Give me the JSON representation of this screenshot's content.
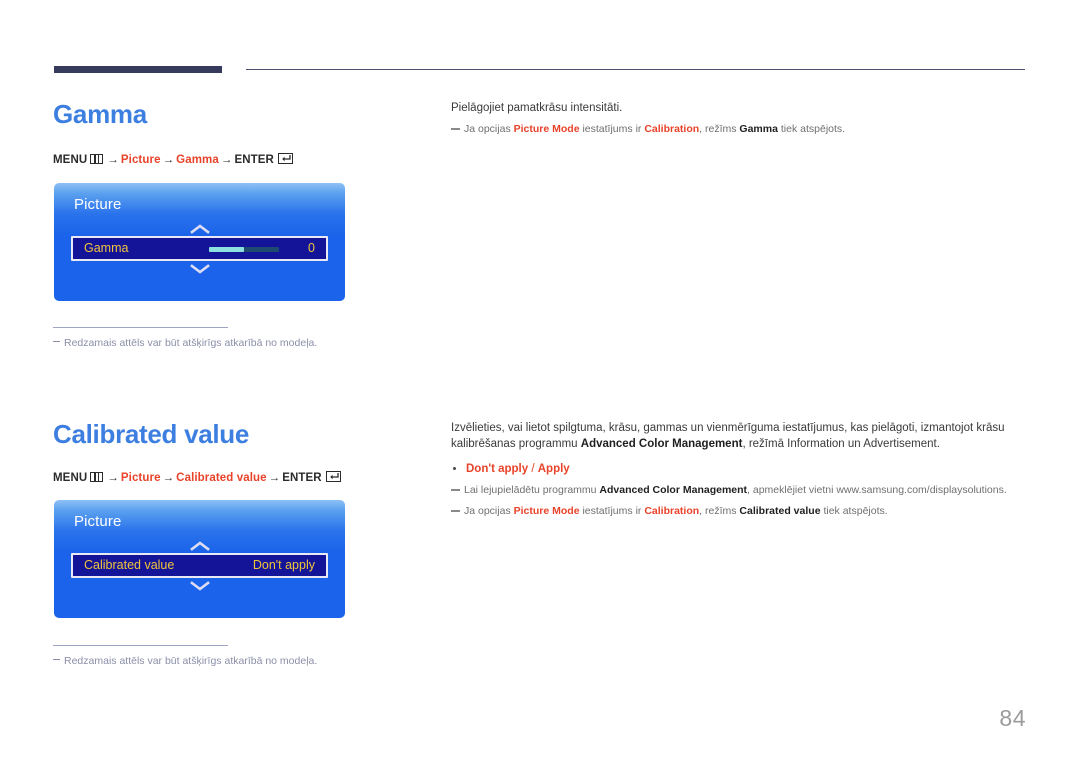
{
  "page": {
    "number": "84"
  },
  "header": {
    "bar_color": "#363b5e",
    "line_color": "#4d5272"
  },
  "sections": [
    {
      "id": "gamma",
      "heading": "Gamma",
      "menu_path": {
        "menu_label": "MENU",
        "menu_icon": "menu-grid-icon",
        "step1": "Picture",
        "step2": "Gamma",
        "enter_label": "ENTER",
        "enter_icon": "enter-return-icon",
        "arrow": "→"
      },
      "osd": {
        "title": "Picture",
        "up_icon": "chevron-up-icon",
        "down_icon": "chevron-down-icon",
        "row_label": "Gamma",
        "row_value": "0",
        "slider_percent": 50
      },
      "footnote": "Redzamais attēls var būt atšķirīgs atkarībā no modeļa.",
      "body": "Pielāgojiet pamatkrāsu intensitāti.",
      "note1": {
        "pre": "Ja opcijas ",
        "b1": "Picture Mode",
        "mid1": " iestatījums ir ",
        "b2": "Calibration",
        "mid2": ", režīms ",
        "b3": "Gamma",
        "post": " tiek atspējots."
      }
    },
    {
      "id": "calibrated-value",
      "heading": "Calibrated value",
      "menu_path": {
        "menu_label": "MENU",
        "menu_icon": "menu-grid-icon",
        "step1": "Picture",
        "step2": "Calibrated value",
        "enter_label": "ENTER",
        "enter_icon": "enter-return-icon",
        "arrow": "→"
      },
      "osd": {
        "title": "Picture",
        "up_icon": "chevron-up-icon",
        "down_icon": "chevron-down-icon",
        "row_label": "Calibrated value",
        "row_value": "Don't apply"
      },
      "footnote": "Redzamais attēls var būt atšķirīgs atkarībā no modeļa.",
      "body": {
        "pre": "Izvēlieties, vai lietot spilgtuma, krāsu, gammas un vienmērīguma iestatījumus, kas pielāgoti, izmantojot krāsu kalibrēšanas programmu ",
        "b1": "Advanced Color Management",
        "post": ", režīmā Information un Advertisement."
      },
      "bullet": {
        "opt1": "Don't apply",
        "sep": " / ",
        "opt2": "Apply"
      },
      "note1": {
        "pre": "Lai lejupielādētu programmu ",
        "b1": "Advanced Color Management",
        "post": ", apmeklējiet vietni www.samsung.com/displaysolutions."
      },
      "note2": {
        "pre": "Ja opcijas ",
        "b1": "Picture Mode",
        "mid1": " iestatījums ir ",
        "b2": "Calibration",
        "mid2": ", režīms ",
        "b3": "Calibrated value",
        "post": " tiek atspējots."
      }
    }
  ],
  "colors": {
    "heading": "#3d7fe0",
    "accent_red": "#e8432a",
    "osd_blue": "#1a63ea",
    "osd_row": "#141499",
    "osd_text": "#f0c43c",
    "slider_fill": "#8de0e0",
    "slider_track": "#1d4a6e"
  }
}
